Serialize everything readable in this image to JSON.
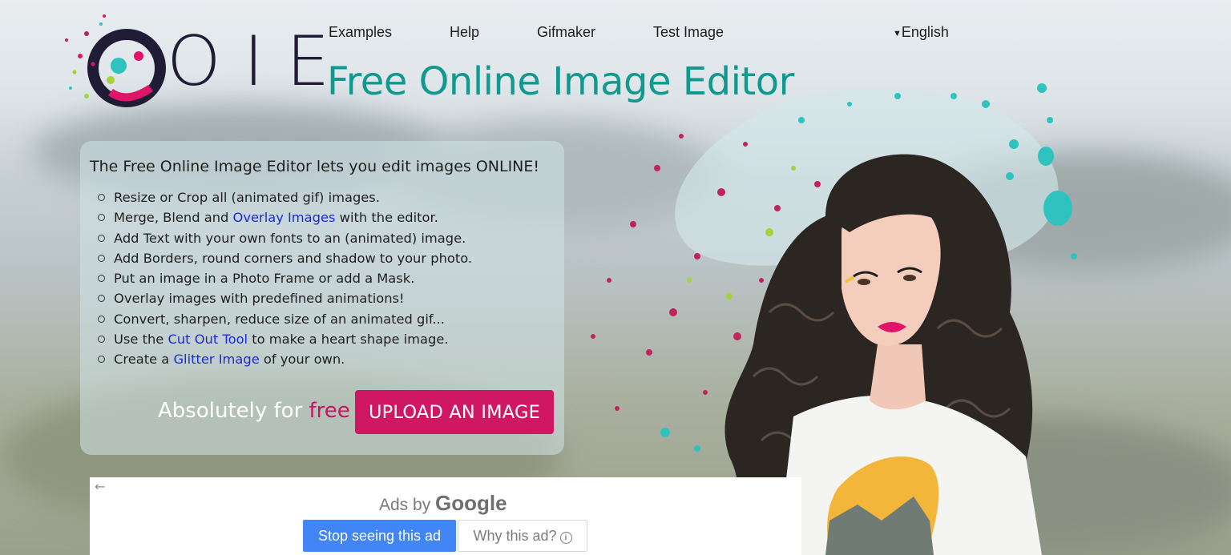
{
  "logo": {
    "text": "OIE"
  },
  "nav": {
    "items": [
      "Examples",
      "Help",
      "Gifmaker",
      "Test Image"
    ]
  },
  "language": {
    "selected": "English"
  },
  "page_title": "Free Online Image Editor",
  "intro": "The Free Online Image Editor lets you edit images ONLINE!",
  "features": [
    {
      "before": "Resize or Crop all (animated gif) images.",
      "link": "",
      "after": ""
    },
    {
      "before": "Merge, Blend and ",
      "link": "Overlay Images",
      "after": " with the editor."
    },
    {
      "before": "Add Text with your own fonts to an (animated) image.",
      "link": "",
      "after": ""
    },
    {
      "before": "Add Borders, round corners and shadow to your photo.",
      "link": "",
      "after": ""
    },
    {
      "before": "Put an image in a Photo Frame or add a Mask.",
      "link": "",
      "after": ""
    },
    {
      "before": "Overlay images with predefined animations!",
      "link": "",
      "after": ""
    },
    {
      "before": "Convert, sharpen, reduce size of an animated gif...",
      "link": "",
      "after": ""
    },
    {
      "before": "Use the ",
      "link": "Cut Out Tool",
      "after": " to make a heart shape image."
    },
    {
      "before": "Create a ",
      "link": "Glitter Image",
      "after": " of your own."
    }
  ],
  "cta": {
    "text": "Absolutely for ",
    "highlight": "free",
    "button": "UPLOAD AN IMAGE"
  },
  "ad": {
    "back_arrow": "←",
    "ads_by": "Ads by",
    "google": "Google",
    "stop_button": "Stop seeing this ad",
    "why_button": "Why this ad?",
    "info_glyph": "i"
  },
  "colors": {
    "title": "#12998f",
    "accent_pink": "#d01763",
    "link_blue": "#1a2bd8",
    "google_blue": "#4285f4",
    "logo_dark": "#201c35"
  }
}
